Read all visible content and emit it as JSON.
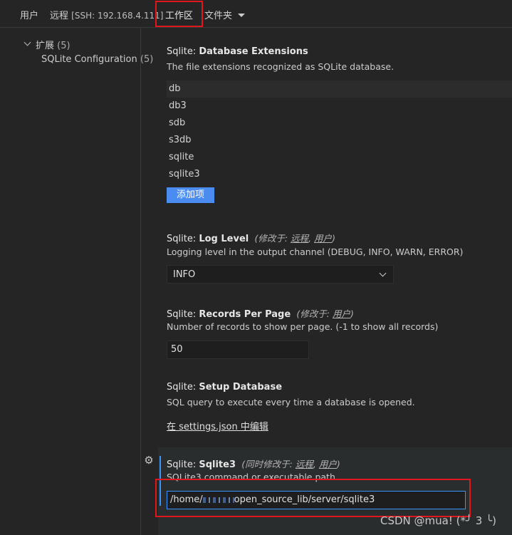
{
  "tabs": {
    "user": "用户",
    "remote": "远程",
    "remote_detail": "[SSH: 192.168.4.111]",
    "workspace": "工作区",
    "folder": "文件夹"
  },
  "sidebar": {
    "group_label": "扩展",
    "group_count": "(5)",
    "child_label": "SQLite Configuration",
    "child_count": "(5)"
  },
  "settings": {
    "db_ext": {
      "prefix": "Sqlite: ",
      "title": "Database Extensions",
      "description": "The file extensions recognized as SQLite database.",
      "items": [
        "db",
        "db3",
        "sdb",
        "s3db",
        "sqlite",
        "sqlite3"
      ],
      "add_label": "添加项"
    },
    "log_level": {
      "prefix": "Sqlite: ",
      "title": "Log Level",
      "modified_prefix": "(修改于: ",
      "modified_remote": "远程",
      "modified_user": "用户",
      "modified_suffix": ")",
      "description": "Logging level in the output channel (DEBUG, INFO, WARN, ERROR)",
      "value": "INFO"
    },
    "records_per_page": {
      "prefix": "Sqlite: ",
      "title": "Records Per Page",
      "modified_prefix": "(修改于: ",
      "modified_user": "用户",
      "modified_suffix": ")",
      "description": "Number of records to show per page. (-1 to show all records)",
      "value": "50"
    },
    "setup_db": {
      "prefix": "Sqlite: ",
      "title": "Setup Database",
      "description": "SQL query to execute every time a database is opened.",
      "link": "在 settings.json 中编辑"
    },
    "sqlite3": {
      "prefix": "Sqlite: ",
      "title": "Sqlite3",
      "modified_prefix": "(同时修改于: ",
      "modified_remote": "远程",
      "modified_user": "用户",
      "modified_suffix": ")",
      "description": "SQLite3 command or executable path.",
      "value_start": "/home/",
      "value_end": "open_source_lib/server/sqlite3"
    }
  },
  "watermark": "CSDN @mua! (*╯ 3 ╰)",
  "colors": {
    "highlight": "#e0171c",
    "accent": "#3794ff",
    "button": "#4a8cf0"
  },
  "icons": [
    "chevron-down-icon",
    "gear-icon",
    "caret-down-icon"
  ]
}
